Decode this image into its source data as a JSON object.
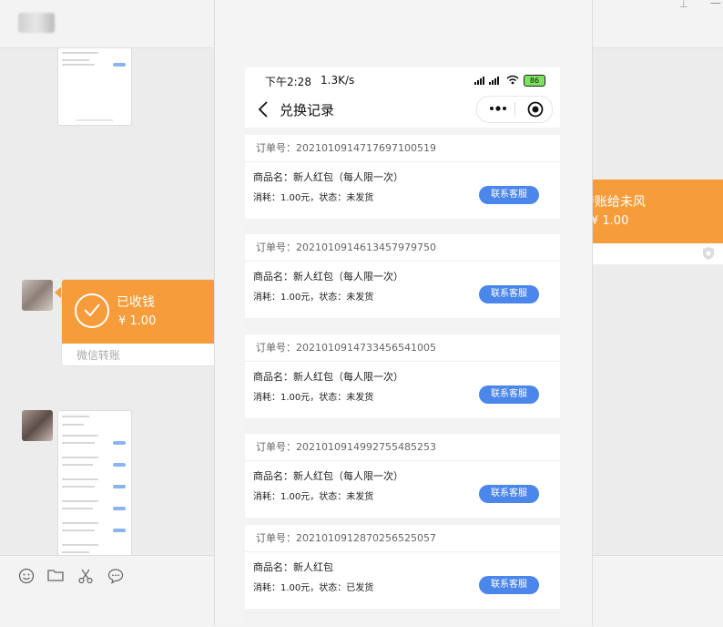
{
  "chat": {
    "received_card": {
      "title": "已收钱",
      "amount": "¥ 1.00",
      "source": "微信转账"
    },
    "sent_card": {
      "title": "转账给未风",
      "amount": "¥ 1.00"
    },
    "toolbar_icons": [
      "emoji-icon",
      "folder-icon",
      "scissors-icon",
      "chat-bubble-icon"
    ]
  },
  "phone": {
    "status": {
      "time": "下午2:28",
      "speed": "1.3K/s",
      "battery": "86"
    },
    "nav": {
      "title": "兑换记录"
    },
    "orders": [
      {
        "order_label": "订单号：2021010914717697100519",
        "product": "商品名：新人红包（每人限一次）",
        "meta": "消耗：1.00元，状态：未发货",
        "button": "联系客服"
      },
      {
        "order_label": "订单号：2021010914613457979750",
        "product": "商品名：新人红包（每人限一次）",
        "meta": "消耗：1.00元，状态：未发货",
        "button": "联系客服"
      },
      {
        "order_label": "订单号：2021010914733456541005",
        "product": "商品名：新人红包（每人限一次）",
        "meta": "消耗：1.00元，状态：未发货",
        "button": "联系客服"
      },
      {
        "order_label": "订单号：2021010914992755485253",
        "product": "商品名：新人红包（每人限一次）",
        "meta": "消耗：1.00元，状态：未发货",
        "button": "联系客服"
      },
      {
        "order_label": "订单号：2021010912870256525057",
        "product": "商品名：新人红包",
        "meta": "消耗：1.00元，状态：已发货",
        "button": "联系客服"
      }
    ]
  },
  "colors": {
    "accent": "#4b86ea",
    "transfer": "#f69c3b"
  }
}
